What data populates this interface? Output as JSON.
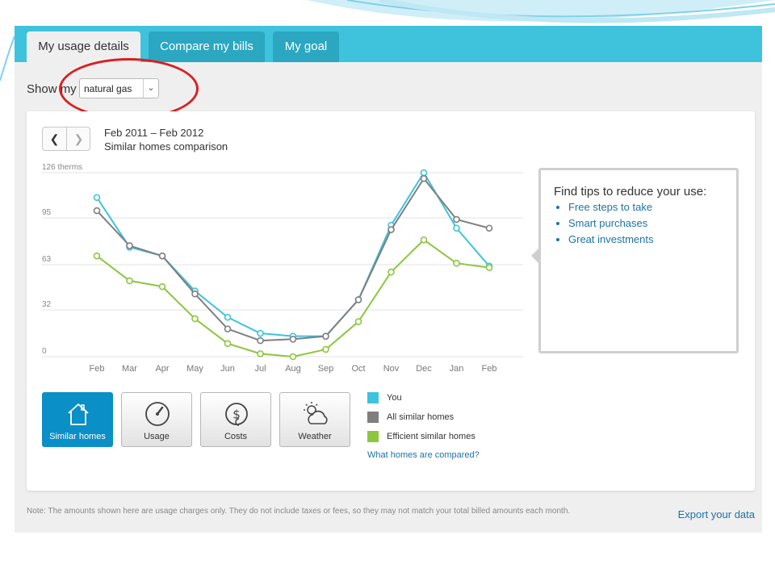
{
  "tabs": [
    {
      "label": "My usage details",
      "active": true
    },
    {
      "label": "Compare my bills",
      "active": false
    },
    {
      "label": "My goal",
      "active": false
    }
  ],
  "fuel": {
    "show_label": "Show my",
    "selected": "natural gas"
  },
  "period": {
    "range": "Feb 2011 – Feb 2012",
    "subtitle": "Similar homes comparison"
  },
  "tips": {
    "title": "Find tips to reduce your use:",
    "items": [
      "Free steps to take",
      "Smart purchases",
      "Great investments"
    ]
  },
  "view_buttons": [
    {
      "label": "Similar homes",
      "icon": "house-icon",
      "active": true
    },
    {
      "label": "Usage",
      "icon": "gauge-icon",
      "active": false
    },
    {
      "label": "Costs",
      "icon": "dollar-coin-icon",
      "active": false
    },
    {
      "label": "Weather",
      "icon": "sun-cloud-icon",
      "active": false
    }
  ],
  "legend": [
    {
      "label": "You",
      "color": "#3ec3dc"
    },
    {
      "label": "All similar homes",
      "color": "#7f7f7f"
    },
    {
      "label": "Efficient similar homes",
      "color": "#8cc63f"
    }
  ],
  "compare_link": "What homes are compared?",
  "note": "Note: The amounts shown here are usage charges only. They do not include taxes or fees, so they may not match your total billed amounts each month.",
  "export_label": "Export your data",
  "chart_data": {
    "type": "line",
    "ylabel": "therms",
    "ytick_labels": [
      "126 therms",
      "95",
      "63",
      "32",
      "0"
    ],
    "yticks": [
      126,
      95,
      63,
      32,
      0
    ],
    "ylim": [
      0,
      126
    ],
    "categories": [
      "Feb",
      "Mar",
      "Apr",
      "May",
      "Jun",
      "Jul",
      "Aug",
      "Sep",
      "Oct",
      "Nov",
      "Dec",
      "Jan",
      "Feb"
    ],
    "grid": true,
    "series": [
      {
        "name": "You",
        "color": "#3ec3dc",
        "values": [
          109,
          75,
          69,
          45,
          27,
          16,
          14,
          14,
          39,
          90,
          126,
          88,
          62
        ]
      },
      {
        "name": "All similar homes",
        "color": "#7f7f7f",
        "values": [
          100,
          76,
          69,
          43,
          19,
          11,
          12,
          14,
          39,
          87,
          122,
          94,
          88
        ]
      },
      {
        "name": "Efficient similar homes",
        "color": "#8cc63f",
        "values": [
          69,
          52,
          48,
          26,
          9,
          2,
          0,
          5,
          24,
          58,
          80,
          64,
          61
        ]
      }
    ]
  }
}
